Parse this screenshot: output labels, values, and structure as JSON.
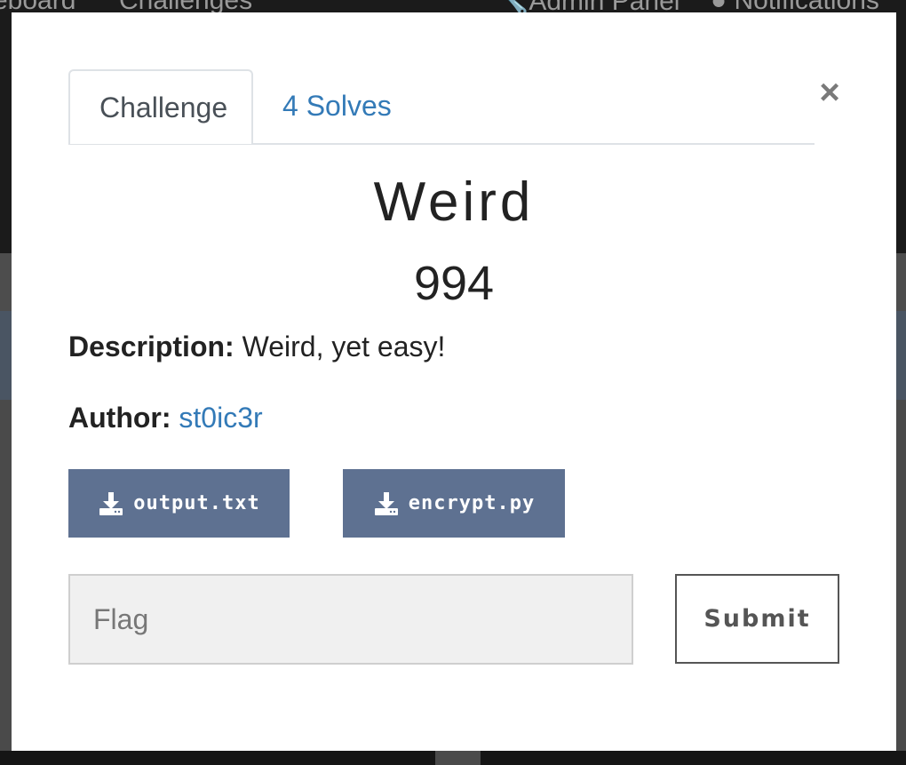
{
  "background": {
    "nav_left_1": "eboard",
    "nav_left_2": "Challenges",
    "nav_right_1": "Admin Panel",
    "nav_right_2": "Notifications"
  },
  "modal": {
    "tabs": [
      {
        "label": "Challenge"
      },
      {
        "label": "4 Solves"
      }
    ],
    "close_symbol": "×",
    "challenge_name": "Weird",
    "challenge_value": "994",
    "description_label": "Description:",
    "description_text": "Weird, yet easy!",
    "author_label": "Author:",
    "author_name": "st0ic3r",
    "files": [
      {
        "label": "output.txt",
        "icon": "download-icon"
      },
      {
        "label": "encrypt.py",
        "icon": "download-icon"
      }
    ],
    "flag_placeholder": "Flag",
    "submit_label": "Submit"
  },
  "colors": {
    "link": "#337ab7",
    "file_button": "#5e7191",
    "overlay_bg": "#2a2a2a"
  }
}
